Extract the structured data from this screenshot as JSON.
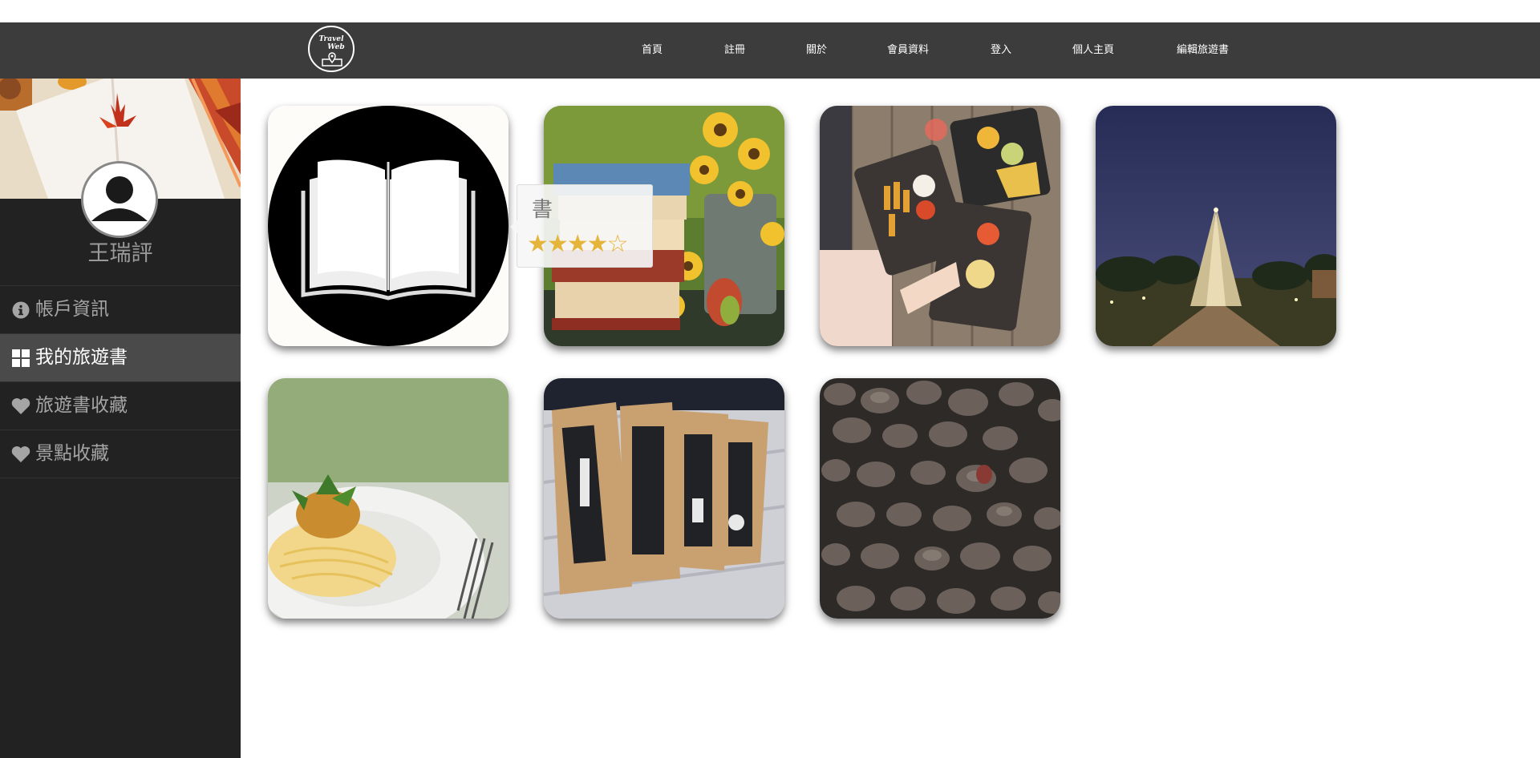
{
  "nav": {
    "logo": {
      "line1": "Travel",
      "line2": "Web"
    },
    "links": [
      {
        "label": "首頁"
      },
      {
        "label": "註冊"
      },
      {
        "label": "關於"
      },
      {
        "label": "會員資料"
      },
      {
        "label": "登入"
      },
      {
        "label": "個人主頁"
      },
      {
        "label": "編輯旅遊書"
      }
    ]
  },
  "sidebar": {
    "username": "王瑞評",
    "items": [
      {
        "label": "帳戶資訊",
        "icon": "info-icon",
        "active": false
      },
      {
        "label": "我的旅遊書",
        "icon": "grid-icon",
        "active": true
      },
      {
        "label": "旅遊書收藏",
        "icon": "heart-icon",
        "active": false
      },
      {
        "label": "景點收藏",
        "icon": "heart-icon",
        "active": false
      }
    ]
  },
  "cards": [
    {
      "image": "open-book-icon"
    },
    {
      "image": "books-and-sunflowers"
    },
    {
      "image": "food-platters-on-table"
    },
    {
      "image": "chapel-at-night"
    },
    {
      "image": "spaghetti-plate"
    },
    {
      "image": "shopping-bags"
    },
    {
      "image": "pebbles"
    }
  ],
  "tooltip": {
    "title": "書",
    "stars": "★★★★☆",
    "rating": 4,
    "max": 5
  },
  "colors": {
    "navbar": "#3c3c3c",
    "sidebar": "#222222",
    "active_item": "#4a4a4a",
    "star": "#e5b43a"
  }
}
